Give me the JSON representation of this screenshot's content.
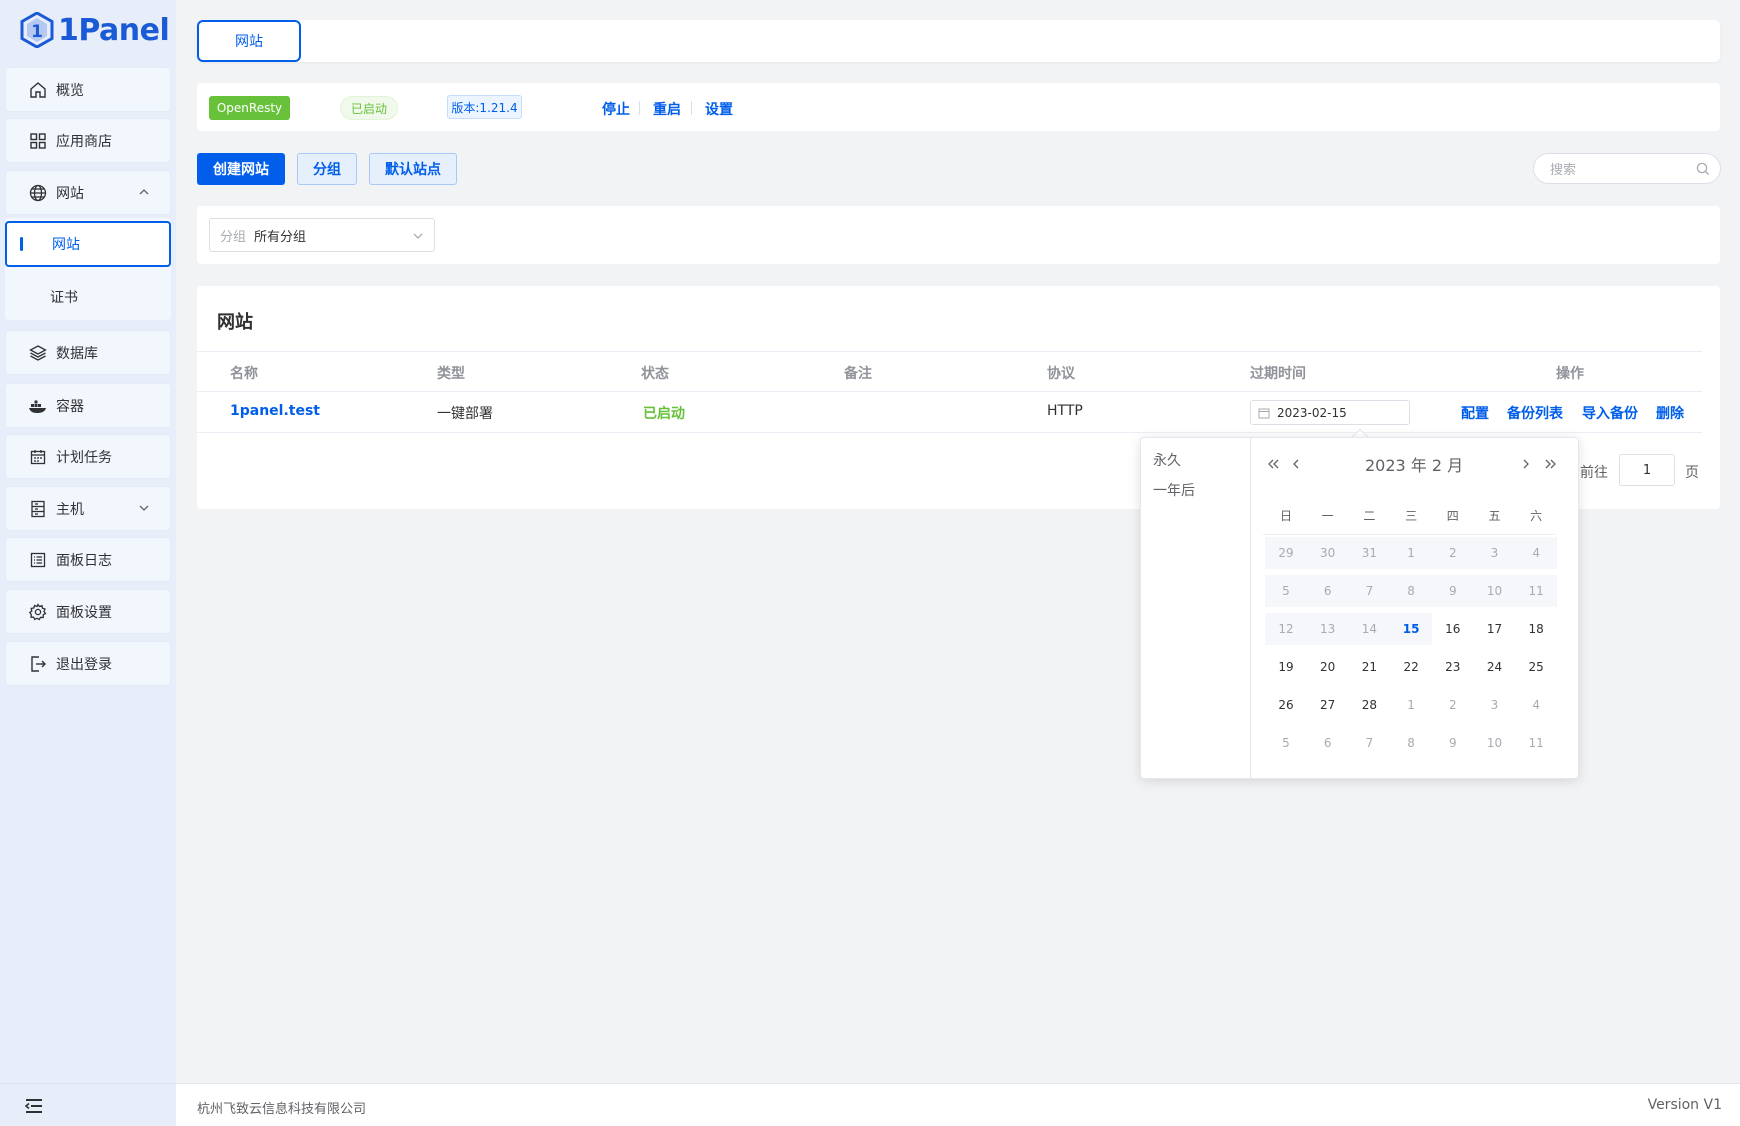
{
  "app": {
    "brand": "1Panel"
  },
  "sidebar": {
    "items": [
      {
        "label": "概览",
        "icon": "home-icon"
      },
      {
        "label": "应用商店",
        "icon": "apps-grid-icon"
      },
      {
        "label": "网站",
        "icon": "globe-icon",
        "expanded": true
      },
      {
        "label": "数据库",
        "icon": "layers-icon"
      },
      {
        "label": "容器",
        "icon": "docker-icon"
      },
      {
        "label": "计划任务",
        "icon": "calendar-icon"
      },
      {
        "label": "主机",
        "icon": "server-icon"
      },
      {
        "label": "面板日志",
        "icon": "log-icon"
      },
      {
        "label": "面板设置",
        "icon": "gear-icon"
      },
      {
        "label": "退出登录",
        "icon": "logout-icon"
      }
    ],
    "submenu": [
      {
        "label": "网站",
        "active": true
      },
      {
        "label": "证书",
        "active": false
      }
    ]
  },
  "tabs": [
    {
      "label": "网站"
    }
  ],
  "status_bar": {
    "app_tag": "OpenResty",
    "status_tag": "已启动",
    "version_tag": "版本:1.21.4",
    "actions": [
      "停止",
      "重启",
      "设置"
    ]
  },
  "toolbar": {
    "create_label": "创建网站",
    "group_label": "分组",
    "default_site_label": "默认站点",
    "search_placeholder": "搜索"
  },
  "filter": {
    "prefix": "分组",
    "value": "所有分组"
  },
  "table": {
    "title": "网站",
    "columns": [
      "名称",
      "类型",
      "状态",
      "备注",
      "协议",
      "过期时间",
      "操作"
    ],
    "rows": [
      {
        "name": "1panel.test",
        "type": "一键部署",
        "status": "已启动",
        "remark": "",
        "protocol": "HTTP",
        "expire": "2023-02-15",
        "ops": [
          "配置",
          "备份列表",
          "导入备份",
          "删除"
        ]
      }
    ]
  },
  "pager": {
    "goto_label": "前往",
    "page": "1",
    "page_suffix": "页"
  },
  "date_picker": {
    "shortcuts": [
      "永久",
      "一年后"
    ],
    "header": "2023 年  2 月",
    "weekdays": [
      "日",
      "一",
      "二",
      "三",
      "四",
      "五",
      "六"
    ],
    "weeks": [
      [
        {
          "d": "29",
          "t": "other",
          "dis": true
        },
        {
          "d": "30",
          "t": "other",
          "dis": true
        },
        {
          "d": "31",
          "t": "other",
          "dis": true
        },
        {
          "d": "1",
          "t": "other",
          "dis": true
        },
        {
          "d": "2",
          "t": "other",
          "dis": true
        },
        {
          "d": "3",
          "t": "other",
          "dis": true
        },
        {
          "d": "4",
          "t": "other",
          "dis": true
        }
      ],
      [
        {
          "d": "5",
          "t": "other",
          "dis": true
        },
        {
          "d": "6",
          "t": "other",
          "dis": true
        },
        {
          "d": "7",
          "t": "other",
          "dis": true
        },
        {
          "d": "8",
          "t": "other",
          "dis": true
        },
        {
          "d": "9",
          "t": "other",
          "dis": true
        },
        {
          "d": "10",
          "t": "other",
          "dis": true
        },
        {
          "d": "11",
          "t": "other",
          "dis": true
        }
      ],
      [
        {
          "d": "12",
          "t": "other",
          "dis": true
        },
        {
          "d": "13",
          "t": "other",
          "dis": true
        },
        {
          "d": "14",
          "t": "other",
          "dis": true
        },
        {
          "d": "15",
          "t": "today",
          "dis": true
        },
        {
          "d": "16",
          "t": "cur"
        },
        {
          "d": "17",
          "t": "cur"
        },
        {
          "d": "18",
          "t": "cur"
        }
      ],
      [
        {
          "d": "19",
          "t": "cur"
        },
        {
          "d": "20",
          "t": "cur"
        },
        {
          "d": "21",
          "t": "cur"
        },
        {
          "d": "22",
          "t": "cur"
        },
        {
          "d": "23",
          "t": "cur"
        },
        {
          "d": "24",
          "t": "cur"
        },
        {
          "d": "25",
          "t": "cur"
        }
      ],
      [
        {
          "d": "26",
          "t": "cur"
        },
        {
          "d": "27",
          "t": "cur"
        },
        {
          "d": "28",
          "t": "cur"
        },
        {
          "d": "1",
          "t": "other"
        },
        {
          "d": "2",
          "t": "other"
        },
        {
          "d": "3",
          "t": "other"
        },
        {
          "d": "4",
          "t": "other"
        }
      ],
      [
        {
          "d": "5",
          "t": "other"
        },
        {
          "d": "6",
          "t": "other"
        },
        {
          "d": "7",
          "t": "other"
        },
        {
          "d": "8",
          "t": "other"
        },
        {
          "d": "9",
          "t": "other"
        },
        {
          "d": "10",
          "t": "other"
        },
        {
          "d": "11",
          "t": "other"
        }
      ]
    ]
  },
  "footer": {
    "company": "杭州飞致云信息科技有限公司",
    "version": "Version V1"
  },
  "colors": {
    "primary": "#005eeb",
    "success": "#67c23a",
    "sidebar_bg": "#e8eef9"
  }
}
